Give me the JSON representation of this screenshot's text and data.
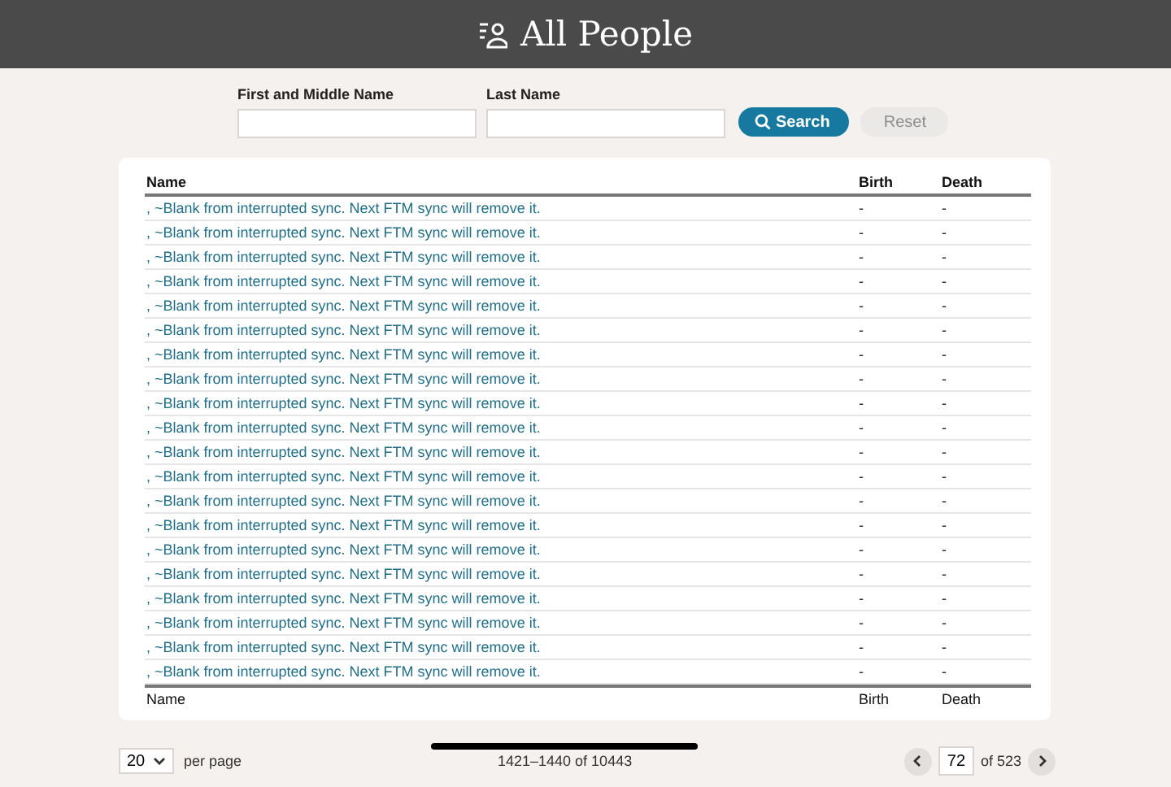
{
  "header": {
    "title": "All People"
  },
  "search": {
    "fields": [
      {
        "label": "First and Middle Name"
      },
      {
        "label": "Last Name"
      }
    ],
    "search_button": "Search",
    "reset_button": {
      "label": "Reset",
      "disabled": true
    }
  },
  "table": {
    "columns": [
      "Name",
      "Birth",
      "Death"
    ],
    "rows": [
      {
        "name": ", ~Blank from interrupted sync. Next FTM sync will remove it.",
        "birth": "-",
        "death": "-"
      },
      {
        "name": ", ~Blank from interrupted sync. Next FTM sync will remove it.",
        "birth": "-",
        "death": "-"
      },
      {
        "name": ", ~Blank from interrupted sync. Next FTM sync will remove it.",
        "birth": "-",
        "death": "-"
      },
      {
        "name": ", ~Blank from interrupted sync. Next FTM sync will remove it.",
        "birth": "-",
        "death": "-"
      },
      {
        "name": ", ~Blank from interrupted sync. Next FTM sync will remove it.",
        "birth": "-",
        "death": "-"
      },
      {
        "name": ", ~Blank from interrupted sync. Next FTM sync will remove it.",
        "birth": "-",
        "death": "-"
      },
      {
        "name": ", ~Blank from interrupted sync. Next FTM sync will remove it.",
        "birth": "-",
        "death": "-"
      },
      {
        "name": ", ~Blank from interrupted sync. Next FTM sync will remove it.",
        "birth": "-",
        "death": "-"
      },
      {
        "name": ", ~Blank from interrupted sync. Next FTM sync will remove it.",
        "birth": "-",
        "death": "-"
      },
      {
        "name": ", ~Blank from interrupted sync. Next FTM sync will remove it.",
        "birth": "-",
        "death": "-"
      },
      {
        "name": ", ~Blank from interrupted sync. Next FTM sync will remove it.",
        "birth": "-",
        "death": "-"
      },
      {
        "name": ", ~Blank from interrupted sync. Next FTM sync will remove it.",
        "birth": "-",
        "death": "-"
      },
      {
        "name": ", ~Blank from interrupted sync. Next FTM sync will remove it.",
        "birth": "-",
        "death": "-"
      },
      {
        "name": ", ~Blank from interrupted sync. Next FTM sync will remove it.",
        "birth": "-",
        "death": "-"
      },
      {
        "name": ", ~Blank from interrupted sync. Next FTM sync will remove it.",
        "birth": "-",
        "death": "-"
      },
      {
        "name": ", ~Blank from interrupted sync. Next FTM sync will remove it.",
        "birth": "-",
        "death": "-"
      },
      {
        "name": ", ~Blank from interrupted sync. Next FTM sync will remove it.",
        "birth": "-",
        "death": "-"
      },
      {
        "name": ", ~Blank from interrupted sync. Next FTM sync will remove it.",
        "birth": "-",
        "death": "-"
      },
      {
        "name": ", ~Blank from interrupted sync. Next FTM sync will remove it.",
        "birth": "-",
        "death": "-"
      },
      {
        "name": ", ~Blank from interrupted sync. Next FTM sync will remove it.",
        "birth": "-",
        "death": "-"
      }
    ],
    "footer_columns": [
      "Name",
      "Birth",
      "Death"
    ]
  },
  "pagination": {
    "page_size": "20",
    "per_page_label": "per page",
    "range": "1421–1440 of 10443",
    "page": "72",
    "page_total": "of 523"
  }
}
